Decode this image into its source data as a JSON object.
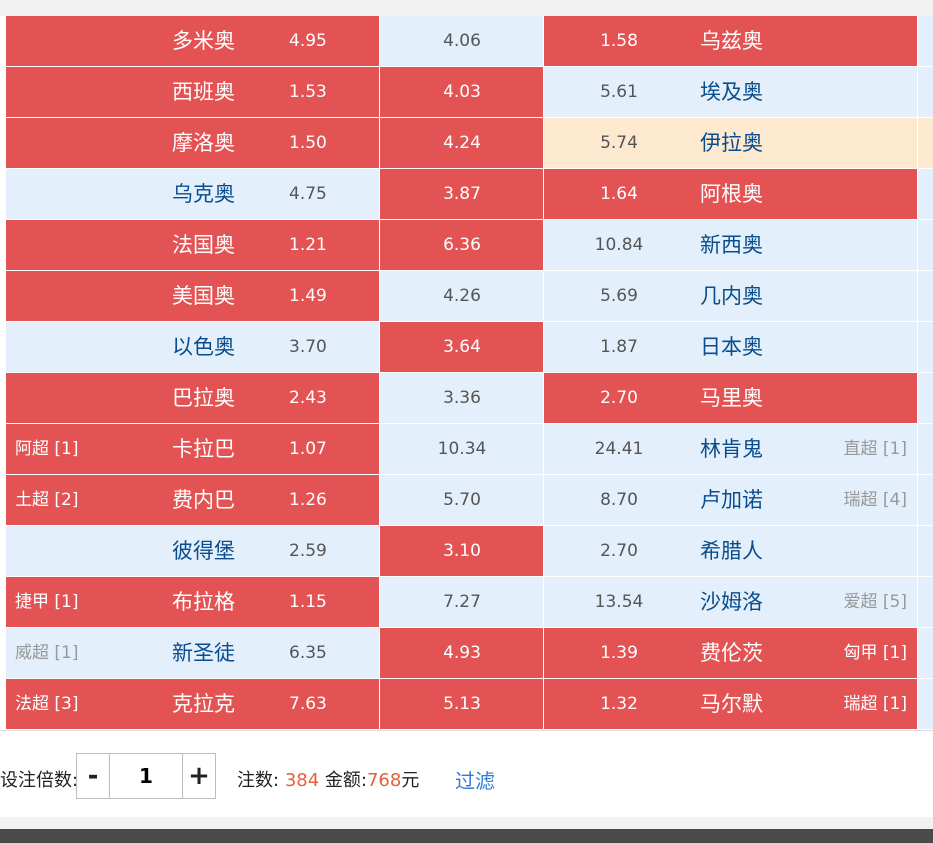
{
  "rows": [
    {
      "home_league": "",
      "home_team": "多米奥",
      "home_odds": "4.95",
      "draw_odds": "4.06",
      "away_odds": "1.58",
      "away_team": "乌兹奥",
      "away_league": "",
      "home_bg": "red",
      "draw_bg": "blue",
      "away_bg": "red"
    },
    {
      "home_league": "",
      "home_team": "西班奥",
      "home_odds": "1.53",
      "draw_odds": "4.03",
      "away_odds": "5.61",
      "away_team": "埃及奥",
      "away_league": "",
      "home_bg": "red",
      "draw_bg": "red",
      "away_bg": "blue"
    },
    {
      "home_league": "",
      "home_team": "摩洛奥",
      "home_odds": "1.50",
      "draw_odds": "4.24",
      "away_odds": "5.74",
      "away_team": "伊拉奥",
      "away_league": "",
      "home_bg": "red",
      "draw_bg": "red",
      "away_bg": "peach"
    },
    {
      "home_league": "",
      "home_team": "乌克奥",
      "home_odds": "4.75",
      "draw_odds": "3.87",
      "away_odds": "1.64",
      "away_team": "阿根奥",
      "away_league": "",
      "home_bg": "blue",
      "draw_bg": "red",
      "away_bg": "red"
    },
    {
      "home_league": "",
      "home_team": "法国奥",
      "home_odds": "1.21",
      "draw_odds": "6.36",
      "away_odds": "10.84",
      "away_team": "新西奥",
      "away_league": "",
      "home_bg": "red",
      "draw_bg": "red",
      "away_bg": "blue"
    },
    {
      "home_league": "",
      "home_team": "美国奥",
      "home_odds": "1.49",
      "draw_odds": "4.26",
      "away_odds": "5.69",
      "away_team": "几内奥",
      "away_league": "",
      "home_bg": "red",
      "draw_bg": "blue",
      "away_bg": "blue"
    },
    {
      "home_league": "",
      "home_team": "以色奥",
      "home_odds": "3.70",
      "draw_odds": "3.64",
      "away_odds": "1.87",
      "away_team": "日本奥",
      "away_league": "",
      "home_bg": "blue",
      "draw_bg": "red",
      "away_bg": "blue"
    },
    {
      "home_league": "",
      "home_team": "巴拉奥",
      "home_odds": "2.43",
      "draw_odds": "3.36",
      "away_odds": "2.70",
      "away_team": "马里奥",
      "away_league": "",
      "home_bg": "red",
      "draw_bg": "blue",
      "away_bg": "red"
    },
    {
      "home_league": "阿超 [1]",
      "home_team": "卡拉巴",
      "home_odds": "1.07",
      "draw_odds": "10.34",
      "away_odds": "24.41",
      "away_team": "林肯鬼",
      "away_league": "直超 [1]",
      "home_bg": "red",
      "draw_bg": "blue",
      "away_bg": "blue"
    },
    {
      "home_league": "土超 [2]",
      "home_team": "费内巴",
      "home_odds": "1.26",
      "draw_odds": "5.70",
      "away_odds": "8.70",
      "away_team": "卢加诺",
      "away_league": "瑞超 [4]",
      "home_bg": "red",
      "draw_bg": "blue",
      "away_bg": "blue"
    },
    {
      "home_league": "",
      "home_team": "彼得堡",
      "home_odds": "2.59",
      "draw_odds": "3.10",
      "away_odds": "2.70",
      "away_team": "希腊人",
      "away_league": "",
      "home_bg": "blue",
      "draw_bg": "red",
      "away_bg": "blue"
    },
    {
      "home_league": "捷甲 [1]",
      "home_team": "布拉格",
      "home_odds": "1.15",
      "draw_odds": "7.27",
      "away_odds": "13.54",
      "away_team": "沙姆洛",
      "away_league": "爱超 [5]",
      "home_bg": "red",
      "draw_bg": "blue",
      "away_bg": "blue"
    },
    {
      "home_league": "威超 [1]",
      "home_team": "新圣徒",
      "home_odds": "6.35",
      "draw_odds": "4.93",
      "away_odds": "1.39",
      "away_team": "费伦茨",
      "away_league": "匈甲 [1]",
      "home_bg": "blue",
      "draw_bg": "red",
      "away_bg": "red"
    },
    {
      "home_league": "法超 [3]",
      "home_team": "克拉克",
      "home_odds": "7.63",
      "draw_odds": "5.13",
      "away_odds": "1.32",
      "away_team": "马尔默",
      "away_league": "瑞超 [1]",
      "home_bg": "red",
      "draw_bg": "red",
      "away_bg": "red"
    }
  ],
  "footer": {
    "multiplier_label": "设注倍数:",
    "minus_label": "-",
    "plus_label": "+",
    "multiplier_value": "1",
    "bets_label": "注数:",
    "bets_count": "384",
    "amount_label": "金额:",
    "amount_value": "768",
    "currency": "元",
    "filter_label": "过滤"
  },
  "colors": {
    "red": "#e35353",
    "blue": "#e3f0fb",
    "peach": "#fde9cf",
    "accent": "#e3603a",
    "link": "#2f7bd6"
  }
}
